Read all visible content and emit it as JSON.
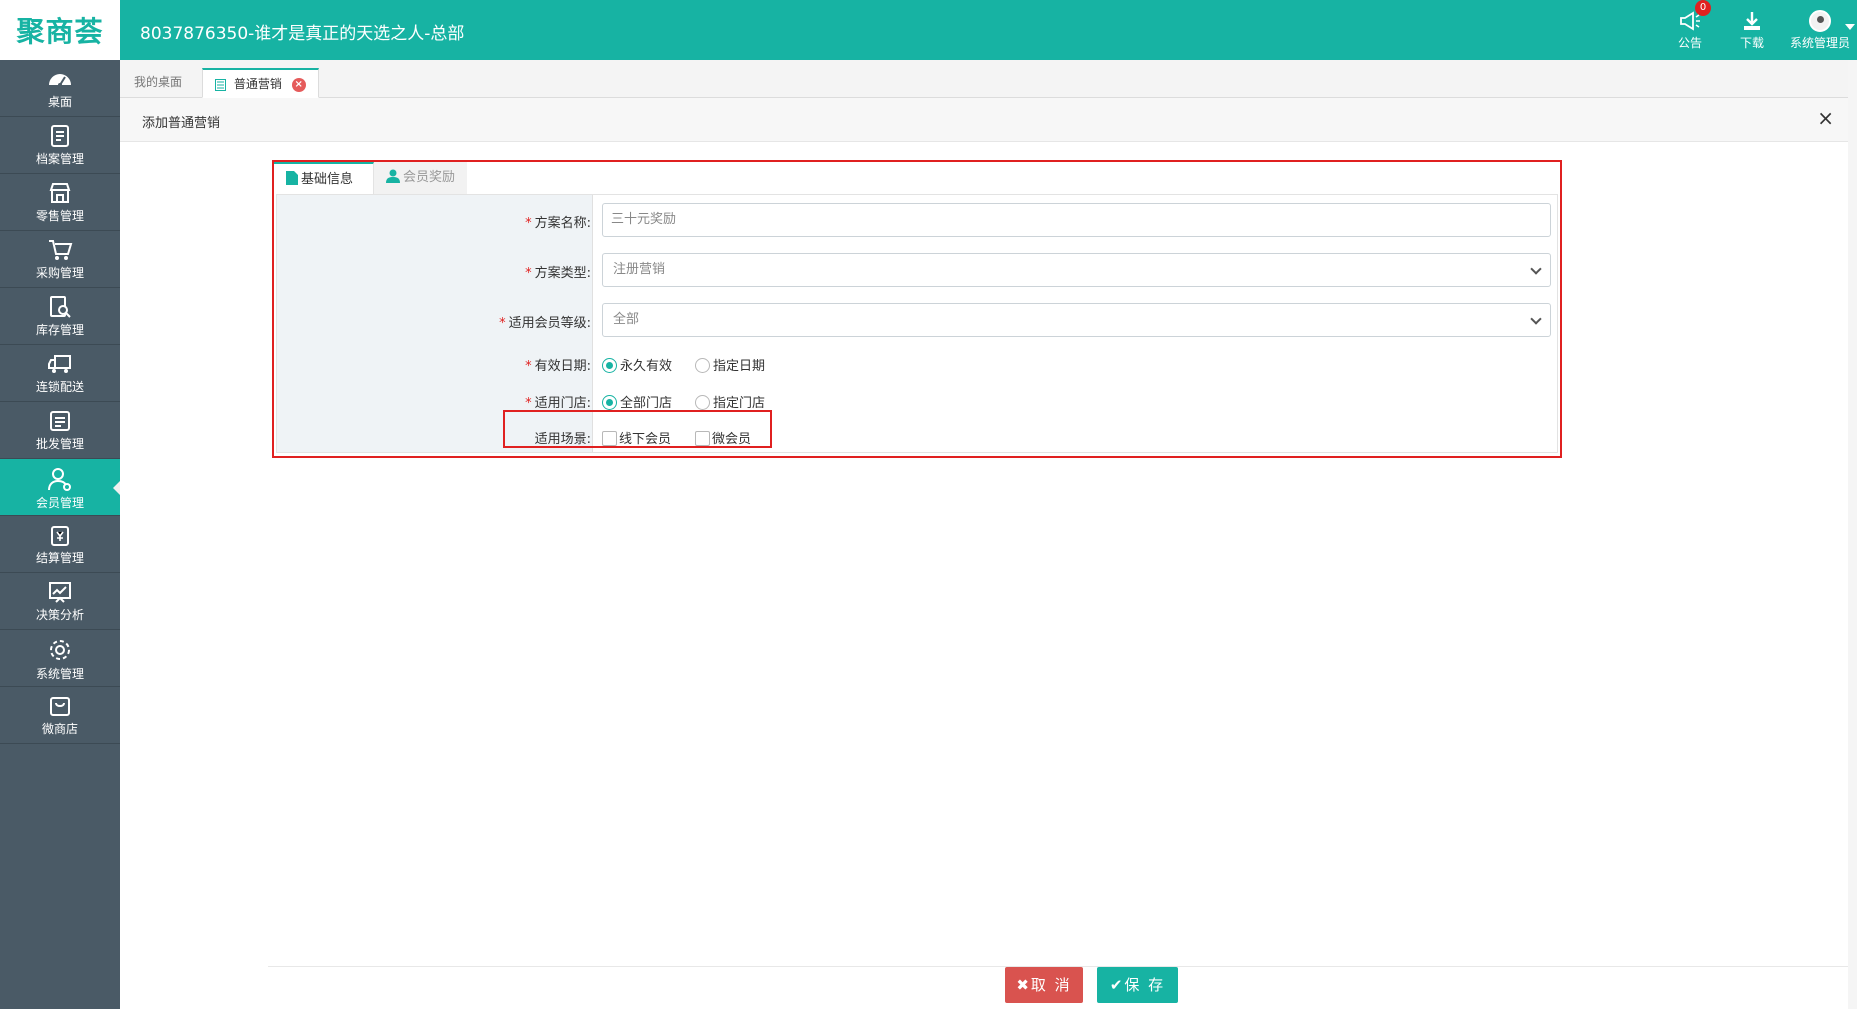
{
  "app": {
    "logo": "聚商荟",
    "company": "8037876350-谁才是真正的天选之人-总部",
    "accent_color": "#17b3a3"
  },
  "top_actions": {
    "notice_label": "公告",
    "notice_badge": "0",
    "download_label": "下载",
    "user_label": "系统管理员"
  },
  "sidebar": {
    "items": [
      {
        "label": "桌面",
        "icon": "dashboard-icon"
      },
      {
        "label": "档案管理",
        "icon": "archive-icon"
      },
      {
        "label": "零售管理",
        "icon": "store-icon"
      },
      {
        "label": "采购管理",
        "icon": "cart-icon"
      },
      {
        "label": "库存管理",
        "icon": "inventory-search-icon"
      },
      {
        "label": "连锁配送",
        "icon": "truck-icon"
      },
      {
        "label": "批发管理",
        "icon": "wholesale-icon"
      },
      {
        "label": "会员管理",
        "icon": "member-icon",
        "active": true
      },
      {
        "label": "结算管理",
        "icon": "settlement-icon"
      },
      {
        "label": "决策分析",
        "icon": "chart-icon"
      },
      {
        "label": "系统管理",
        "icon": "gear-icon"
      },
      {
        "label": "微商店",
        "icon": "bag-icon"
      }
    ]
  },
  "page_tabs": {
    "home": "我的桌面",
    "current": "普通营销"
  },
  "window": {
    "title": "添加普通营销",
    "close": "×"
  },
  "form": {
    "tabs": {
      "basic": "基础信息",
      "reward": "会员奖励"
    },
    "fields": {
      "name_label": "方案名称:",
      "name_value": "三十元奖励",
      "type_label": "方案类型:",
      "type_value": "注册营销",
      "level_label": "适用会员等级:",
      "level_value": "全部",
      "date_label": "有效日期:",
      "date_opt1": "永久有效",
      "date_opt2": "指定日期",
      "store_label": "适用门店:",
      "store_opt1": "全部门店",
      "store_opt2": "指定门店",
      "scene_label": "适用场景:",
      "scene_opt1": "线下会员",
      "scene_opt2": "微会员"
    },
    "required_mark": "*"
  },
  "footer": {
    "cancel": "取 消",
    "save": "保 存"
  }
}
